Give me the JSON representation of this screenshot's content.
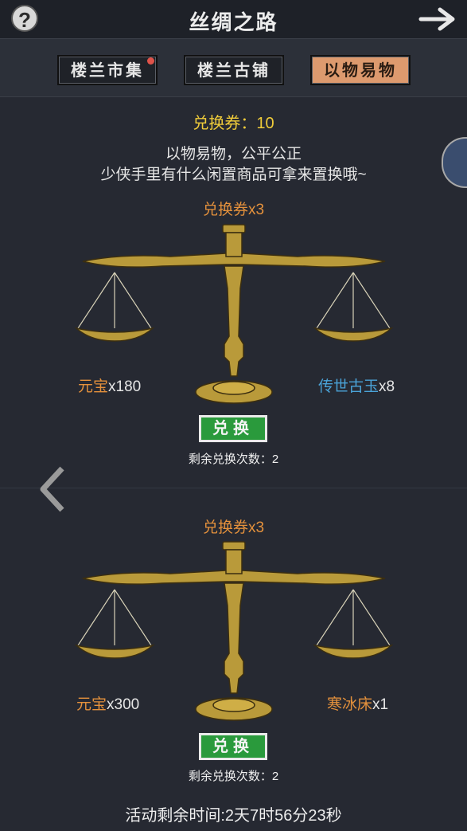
{
  "header": {
    "help_label": "?",
    "title": "丝绸之路",
    "icons": {
      "help": "question-icon",
      "next": "arrow-right-icon"
    }
  },
  "tabs": [
    {
      "label": "楼兰市集",
      "active": false,
      "has_notification": true
    },
    {
      "label": "楼兰古铺",
      "active": false,
      "has_notification": false
    },
    {
      "label": "以物易物",
      "active": true,
      "has_notification": false
    }
  ],
  "voucher_text": "兑换券：10",
  "description": {
    "line1": "以物易物，公平公正",
    "line2": "少侠手里有什么闲置商品可拿来置换哦~"
  },
  "trades": [
    {
      "cost": "兑换券x3",
      "left_item": {
        "name": "元宝",
        "qty": "x180",
        "color": "#e4913c"
      },
      "right_item": {
        "name": "传世古玉",
        "qty": "x8",
        "color": "#4aa3d8"
      },
      "button_label": "兑换",
      "remaining": "剩余兑换次数：2"
    },
    {
      "cost": "兑换券x3",
      "left_item": {
        "name": "元宝",
        "qty": "x300",
        "color": "#e4913c"
      },
      "right_item": {
        "name": "寒冰床",
        "qty": "x1",
        "color": "#e4913c"
      },
      "button_label": "兑换",
      "remaining": "剩余兑换次数：2"
    }
  ],
  "timer_text": "活动剩余时间:2天7时56分23秒",
  "colors": {
    "accent_gold": "#f0cc3a",
    "cost_orange": "#e4913c",
    "exchange_green": "#2a9a3c",
    "active_tab": "#dd9a6e"
  }
}
